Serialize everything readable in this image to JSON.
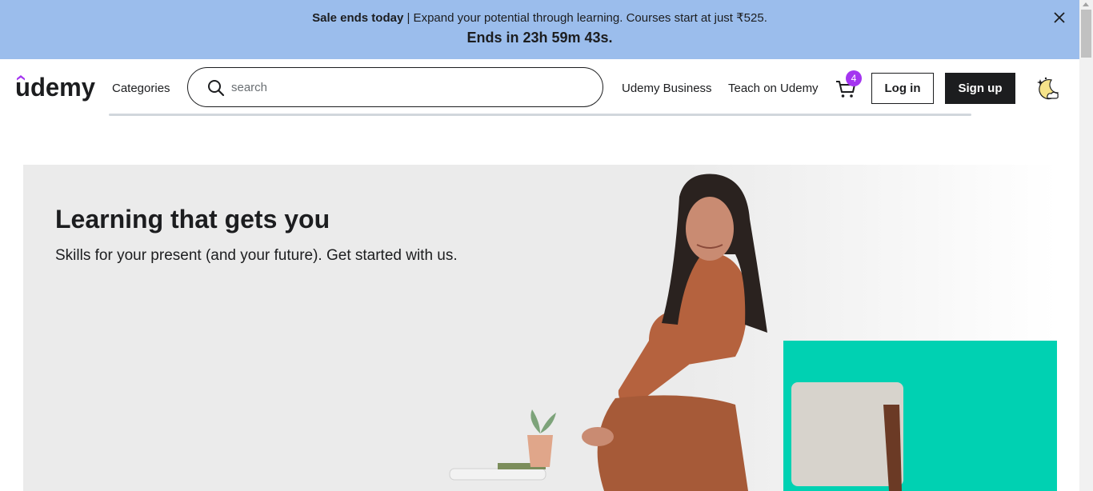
{
  "banner": {
    "sale_bold": "Sale ends today",
    "sale_text": " | Expand your potential through learning. Courses start at just ₹525.",
    "countdown": "Ends in 23h 59m 43s."
  },
  "header": {
    "logo_text": "udemy",
    "categories_label": "Categories",
    "search_placeholder": "search",
    "search_value": "",
    "business_label": "Udemy Business",
    "teach_label": "Teach on Udemy",
    "cart_count": "4",
    "login_label": "Log in",
    "signup_label": "Sign up"
  },
  "hero": {
    "title": "Learning that gets you",
    "subtitle": "Skills for your present (and your future). Get started with us."
  },
  "icons": {
    "banner_close": "close-icon",
    "search": "search-icon",
    "cart": "shopping-cart-icon",
    "theme": "night-mode-icon"
  },
  "colors": {
    "banner_bg": "#9bbdec",
    "brand_purple": "#a435f0",
    "dark": "#1c1d1f",
    "hero_bg": "#ebebeb",
    "hero_accent": "#00d1b2"
  }
}
